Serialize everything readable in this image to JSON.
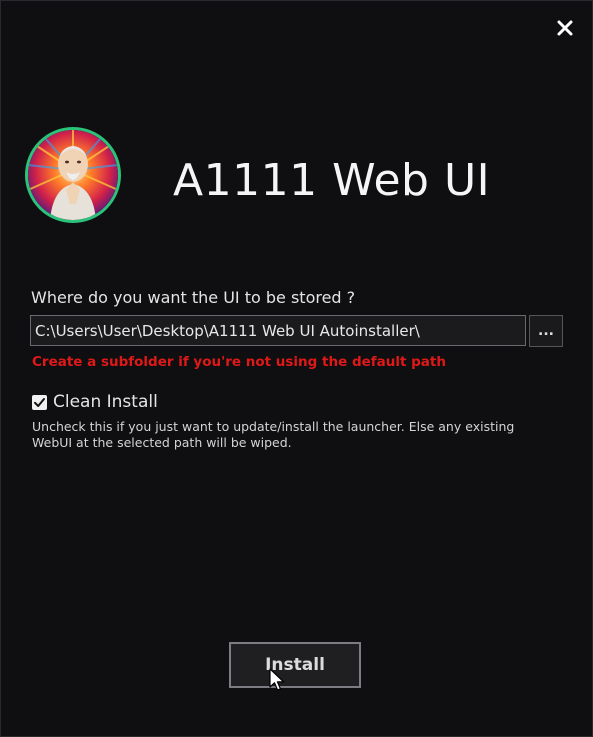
{
  "window": {
    "title": "A1111 Web UI",
    "close_icon": "close-icon"
  },
  "avatar": {
    "icon": "portrait-avatar",
    "ring_color": "#29c47a"
  },
  "path": {
    "prompt": "Where do you want the UI to be stored ?",
    "value": "C:\\Users\\User\\Desktop\\A1111 Web UI Autoinstaller\\",
    "browse_label": "...",
    "warning": "Create a subfolder if you're not using the default path",
    "warning_color": "#e01818"
  },
  "clean_install": {
    "label": "Clean Install",
    "checked": true,
    "hint": "Uncheck this if you just want to update/install the launcher. Else any existing WebUI at the selected path will be wiped."
  },
  "actions": {
    "install_label": "Install"
  }
}
